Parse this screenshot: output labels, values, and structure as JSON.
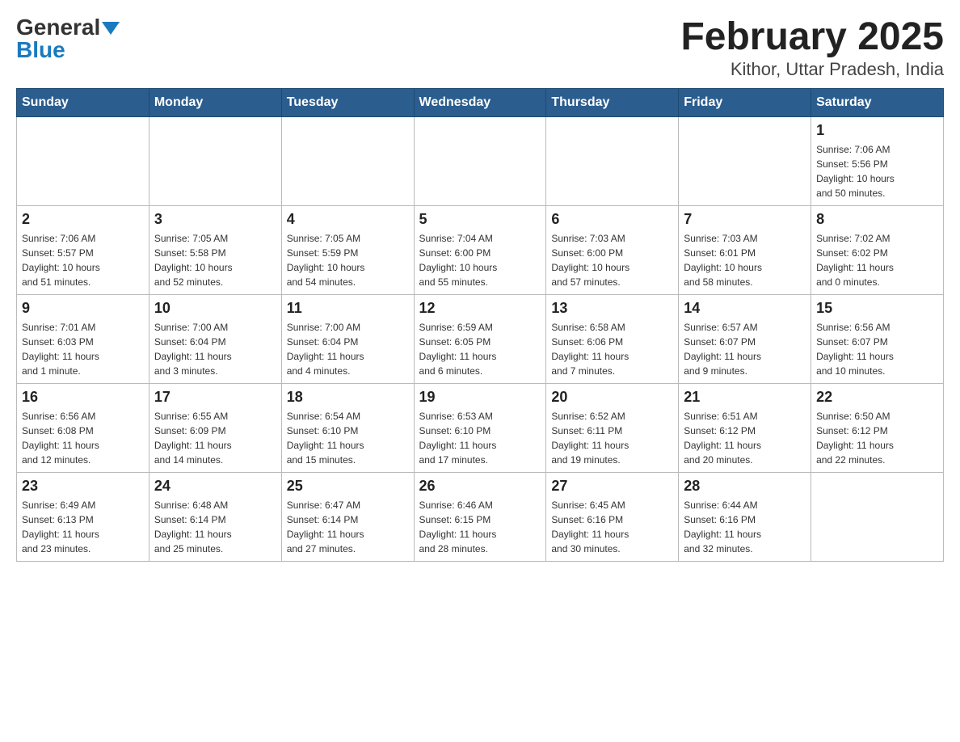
{
  "header": {
    "logo_general": "General",
    "logo_blue": "Blue",
    "title": "February 2025",
    "subtitle": "Kithor, Uttar Pradesh, India"
  },
  "days": [
    "Sunday",
    "Monday",
    "Tuesday",
    "Wednesday",
    "Thursday",
    "Friday",
    "Saturday"
  ],
  "weeks": [
    [
      {
        "day": "",
        "info": ""
      },
      {
        "day": "",
        "info": ""
      },
      {
        "day": "",
        "info": ""
      },
      {
        "day": "",
        "info": ""
      },
      {
        "day": "",
        "info": ""
      },
      {
        "day": "",
        "info": ""
      },
      {
        "day": "1",
        "info": "Sunrise: 7:06 AM\nSunset: 5:56 PM\nDaylight: 10 hours\nand 50 minutes."
      }
    ],
    [
      {
        "day": "2",
        "info": "Sunrise: 7:06 AM\nSunset: 5:57 PM\nDaylight: 10 hours\nand 51 minutes."
      },
      {
        "day": "3",
        "info": "Sunrise: 7:05 AM\nSunset: 5:58 PM\nDaylight: 10 hours\nand 52 minutes."
      },
      {
        "day": "4",
        "info": "Sunrise: 7:05 AM\nSunset: 5:59 PM\nDaylight: 10 hours\nand 54 minutes."
      },
      {
        "day": "5",
        "info": "Sunrise: 7:04 AM\nSunset: 6:00 PM\nDaylight: 10 hours\nand 55 minutes."
      },
      {
        "day": "6",
        "info": "Sunrise: 7:03 AM\nSunset: 6:00 PM\nDaylight: 10 hours\nand 57 minutes."
      },
      {
        "day": "7",
        "info": "Sunrise: 7:03 AM\nSunset: 6:01 PM\nDaylight: 10 hours\nand 58 minutes."
      },
      {
        "day": "8",
        "info": "Sunrise: 7:02 AM\nSunset: 6:02 PM\nDaylight: 11 hours\nand 0 minutes."
      }
    ],
    [
      {
        "day": "9",
        "info": "Sunrise: 7:01 AM\nSunset: 6:03 PM\nDaylight: 11 hours\nand 1 minute."
      },
      {
        "day": "10",
        "info": "Sunrise: 7:00 AM\nSunset: 6:04 PM\nDaylight: 11 hours\nand 3 minutes."
      },
      {
        "day": "11",
        "info": "Sunrise: 7:00 AM\nSunset: 6:04 PM\nDaylight: 11 hours\nand 4 minutes."
      },
      {
        "day": "12",
        "info": "Sunrise: 6:59 AM\nSunset: 6:05 PM\nDaylight: 11 hours\nand 6 minutes."
      },
      {
        "day": "13",
        "info": "Sunrise: 6:58 AM\nSunset: 6:06 PM\nDaylight: 11 hours\nand 7 minutes."
      },
      {
        "day": "14",
        "info": "Sunrise: 6:57 AM\nSunset: 6:07 PM\nDaylight: 11 hours\nand 9 minutes."
      },
      {
        "day": "15",
        "info": "Sunrise: 6:56 AM\nSunset: 6:07 PM\nDaylight: 11 hours\nand 10 minutes."
      }
    ],
    [
      {
        "day": "16",
        "info": "Sunrise: 6:56 AM\nSunset: 6:08 PM\nDaylight: 11 hours\nand 12 minutes."
      },
      {
        "day": "17",
        "info": "Sunrise: 6:55 AM\nSunset: 6:09 PM\nDaylight: 11 hours\nand 14 minutes."
      },
      {
        "day": "18",
        "info": "Sunrise: 6:54 AM\nSunset: 6:10 PM\nDaylight: 11 hours\nand 15 minutes."
      },
      {
        "day": "19",
        "info": "Sunrise: 6:53 AM\nSunset: 6:10 PM\nDaylight: 11 hours\nand 17 minutes."
      },
      {
        "day": "20",
        "info": "Sunrise: 6:52 AM\nSunset: 6:11 PM\nDaylight: 11 hours\nand 19 minutes."
      },
      {
        "day": "21",
        "info": "Sunrise: 6:51 AM\nSunset: 6:12 PM\nDaylight: 11 hours\nand 20 minutes."
      },
      {
        "day": "22",
        "info": "Sunrise: 6:50 AM\nSunset: 6:12 PM\nDaylight: 11 hours\nand 22 minutes."
      }
    ],
    [
      {
        "day": "23",
        "info": "Sunrise: 6:49 AM\nSunset: 6:13 PM\nDaylight: 11 hours\nand 23 minutes."
      },
      {
        "day": "24",
        "info": "Sunrise: 6:48 AM\nSunset: 6:14 PM\nDaylight: 11 hours\nand 25 minutes."
      },
      {
        "day": "25",
        "info": "Sunrise: 6:47 AM\nSunset: 6:14 PM\nDaylight: 11 hours\nand 27 minutes."
      },
      {
        "day": "26",
        "info": "Sunrise: 6:46 AM\nSunset: 6:15 PM\nDaylight: 11 hours\nand 28 minutes."
      },
      {
        "day": "27",
        "info": "Sunrise: 6:45 AM\nSunset: 6:16 PM\nDaylight: 11 hours\nand 30 minutes."
      },
      {
        "day": "28",
        "info": "Sunrise: 6:44 AM\nSunset: 6:16 PM\nDaylight: 11 hours\nand 32 minutes."
      },
      {
        "day": "",
        "info": ""
      }
    ]
  ]
}
